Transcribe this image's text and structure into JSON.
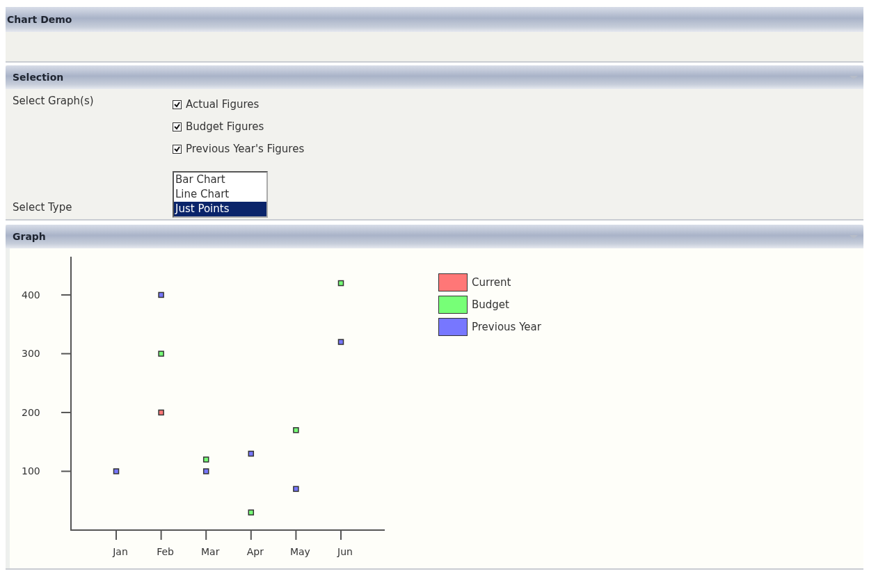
{
  "window": {
    "title": "Chart Demo"
  },
  "selection": {
    "title": "Selection",
    "graphs_label": "Select Graph(s)",
    "graphs": [
      {
        "label": "Actual Figures",
        "checked": true
      },
      {
        "label": "Budget Figures",
        "checked": true
      },
      {
        "label": "Previous Year's Figures",
        "checked": true
      }
    ],
    "type_label": "Select Type",
    "types": [
      {
        "label": "Bar Chart",
        "selected": false
      },
      {
        "label": "Line Chart",
        "selected": false
      },
      {
        "label": "Just Points",
        "selected": true
      }
    ]
  },
  "graph": {
    "title": "Graph",
    "chart_data": {
      "type": "scatter",
      "categories": [
        "Jan",
        "Feb",
        "Mar",
        "Apr",
        "May",
        "Jun"
      ],
      "yticks": [
        100,
        200,
        300,
        400
      ],
      "ylim": [
        0,
        465
      ],
      "series": [
        {
          "name": "Current",
          "color": "#ff7777",
          "values": [
            null,
            200,
            null,
            null,
            null,
            null
          ]
        },
        {
          "name": "Budget",
          "color": "#77ff77",
          "values": [
            null,
            300,
            120,
            30,
            170,
            420
          ]
        },
        {
          "name": "Previous Year",
          "color": "#7777ff",
          "values": [
            100,
            400,
            100,
            130,
            70,
            320
          ]
        }
      ]
    }
  }
}
